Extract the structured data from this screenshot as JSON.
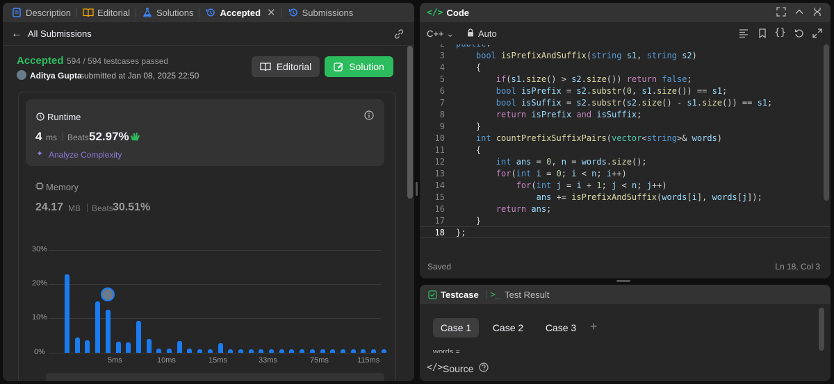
{
  "tabs": [
    {
      "label": "Description",
      "icon": "description-icon",
      "color": "#3f86ff"
    },
    {
      "label": "Editorial",
      "icon": "book-icon",
      "color": "#f0a500"
    },
    {
      "label": "Solutions",
      "icon": "flask-icon",
      "color": "#3f86ff"
    },
    {
      "label": "Accepted",
      "icon": "history-icon",
      "color": "#3f86ff"
    },
    {
      "label": "Submissions",
      "icon": "history-icon",
      "color": "#3f86ff"
    }
  ],
  "back_label": "All Submissions",
  "result": {
    "status": "Accepted",
    "status_color": "#2cbb5d",
    "testcases": "594 / 594 testcases passed",
    "user": "Aditya Gupta",
    "submitted": "submitted at Jan 08, 2025 22:50"
  },
  "buttons": {
    "editorial": "Editorial",
    "solution": "Solution"
  },
  "runtime": {
    "title": "Runtime",
    "value": "4",
    "unit": "ms",
    "beats_label": "Beats",
    "beats": "52.97%",
    "analyze": "Analyze Complexity"
  },
  "memory": {
    "title": "Memory",
    "value": "24.17",
    "unit": "MB",
    "beats_label": "Beats",
    "beats": "30.51%"
  },
  "chart_data": {
    "type": "bar",
    "ylim": [
      0,
      30
    ],
    "y_ticks": [
      "30%",
      "20%",
      "10%",
      "0%"
    ],
    "x_ticks": [
      "5ms",
      "10ms",
      "15ms",
      "33ms",
      "75ms",
      "115ms"
    ],
    "values": [
      23,
      4.5,
      3.6,
      15,
      12.5,
      3.3,
      3.1,
      9.3,
      4,
      1.2,
      1.2,
      3.5,
      1.2,
      1.1,
      1.1,
      2.9,
      1.1,
      1.1,
      1.1,
      1.1,
      1.1,
      1.1,
      1.1,
      1.1,
      1.1,
      1.1,
      1.1,
      1.1,
      1.1,
      1.1,
      1.1,
      1.1
    ],
    "highlight_index": 4
  },
  "code_panel": {
    "title": "Code",
    "language": "C++",
    "mode": "Auto",
    "status": "Saved",
    "cursor": "Ln 18, Col 3"
  },
  "code_lines": [
    {
      "n": "2",
      "t": "public:"
    },
    {
      "n": "3",
      "t": "    bool isPrefixAndSuffix(string s1, string s2)"
    },
    {
      "n": "4",
      "t": "    {"
    },
    {
      "n": "5",
      "t": "        if(s1.size() > s2.size()) return false;"
    },
    {
      "n": "6",
      "t": "        bool isPrefix = s2.substr(0, s1.size()) == s1;"
    },
    {
      "n": "7",
      "t": "        bool isSuffix = s2.substr(s2.size() - s1.size()) == s1;"
    },
    {
      "n": "8",
      "t": "        return isPrefix and isSuffix;"
    },
    {
      "n": "9",
      "t": "    }"
    },
    {
      "n": "10",
      "t": "    int countPrefixSuffixPairs(vector<string>& words)"
    },
    {
      "n": "11",
      "t": "    {"
    },
    {
      "n": "12",
      "t": "        int ans = 0, n = words.size();"
    },
    {
      "n": "13",
      "t": "        for(int i = 0; i < n; i++)"
    },
    {
      "n": "14",
      "t": "            for(int j = i + 1; j < n; j++)"
    },
    {
      "n": "15",
      "t": "                ans += isPrefixAndSuffix(words[i], words[j]);"
    },
    {
      "n": "16",
      "t": "        return ans;"
    },
    {
      "n": "17",
      "t": "    }"
    },
    {
      "n": "18",
      "t": "};"
    }
  ],
  "testcase_panel": {
    "tab1": "Testcase",
    "tab2": "Test Result",
    "cases": [
      "Case 1",
      "Case 2",
      "Case 3"
    ],
    "add": "+",
    "partial": "words =",
    "source": "Source"
  }
}
